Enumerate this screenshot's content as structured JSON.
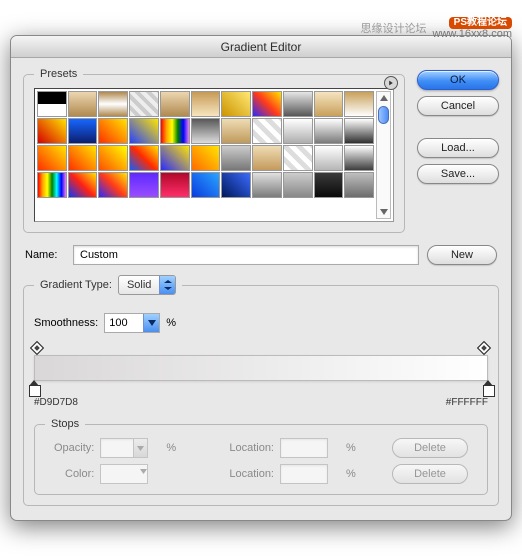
{
  "watermark": {
    "text": "思缘设计论坛",
    "ps": "PS教程论坛",
    "url": "www.16xx8.com"
  },
  "window": {
    "title": "Gradient Editor"
  },
  "presets": {
    "legend": "Presets"
  },
  "buttons": {
    "ok": "OK",
    "cancel": "Cancel",
    "load": "Load...",
    "save": "Save...",
    "new": "New"
  },
  "name": {
    "label": "Name:",
    "value": "Custom"
  },
  "gradient_type": {
    "legend": "Gradient Type:",
    "value": "Solid"
  },
  "smoothness": {
    "label": "Smoothness:",
    "value": "100",
    "unit": "%"
  },
  "stops": {
    "legend": "Stops",
    "opacity_label": "Opacity:",
    "color_label": "Color:",
    "location_label": "Location:",
    "unit": "%",
    "delete": "Delete"
  },
  "color_stops": {
    "left_hex": "#D9D7D8",
    "right_hex": "#FFFFFF"
  },
  "preset_swatches": [
    "linear-gradient(#000 0%,#000 50%,#fff 50%)",
    "linear-gradient(#ecd6b0,#b08a50)",
    "linear-gradient(#b08a50,#fff,#b08a50)",
    "repeating-linear-gradient(45deg,#eee 0 4px,#ccc 4px 8px)",
    "linear-gradient(#ecd6b0,#b08a50)",
    "linear-gradient(#c69a55,#f8e6bf)",
    "linear-gradient(45deg,#cc9400,#ffe873)",
    "linear-gradient(45deg,#2a2aff,#ff3a1a,#ffe400)",
    "linear-gradient(#e6e6e6,#575757)",
    "linear-gradient(#f5e4c0,#c8a05b)",
    "linear-gradient(#c8a05b,#fff)",
    "linear-gradient(45deg,#d50000,#ffe200)",
    "linear-gradient(#1766ff,#0b1e6f)",
    "linear-gradient(45deg,#ff2f00,#ffe400)",
    "linear-gradient(45deg,#2541ff,#ffe400)",
    "linear-gradient(90deg,red,orange,yellow,green,blue,violet)",
    "linear-gradient(#585858,#dcdcdc)",
    "linear-gradient(#eedcb5,#c09a5b)",
    "repeating-linear-gradient(45deg,#fff 0 5px,#ddd 5px 10px)",
    "linear-gradient(#fff,#aeaeae)",
    "linear-gradient(#fff,#7a7a7a)",
    "linear-gradient(#fff,#303030)",
    "linear-gradient(45deg,#ff2f00,#ffe400)",
    "linear-gradient(45deg,#ff2f00,#ffe400)",
    "linear-gradient(45deg,#ff4d00,#ffff00)",
    "linear-gradient(45deg,#105cff,#ff2b00,#ffe400)",
    "linear-gradient(45deg,#2a2aff,#ffe400)",
    "linear-gradient(45deg,#ff6a00,#ffe400)",
    "linear-gradient(#ccc,#777)",
    "linear-gradient(#efdcb4,#c49a5c)",
    "repeating-linear-gradient(45deg,#fff 0 5px,#ddd 5px 10px)",
    "linear-gradient(#fff,#b5b5b5)",
    "linear-gradient(#fff,#3e3e3e)",
    "linear-gradient(90deg,red,orange,yellow,green,cyan,blue,violet)",
    "linear-gradient(45deg,#0c37ff,#ff2214,#ffe200)",
    "linear-gradient(45deg,#2a2aff,#ff3a1a,#ffe400)",
    "linear-gradient(#5e2aff,#9b4dff)",
    "linear-gradient(#b0082b,#ff2f6a)",
    "linear-gradient(45deg,#0a3be0,#2aa4ff)",
    "linear-gradient(45deg,#00185a,#3b6bff)",
    "linear-gradient(#e0e0e0,#7c7c7c)",
    "linear-gradient(#ccc,#888)",
    "linear-gradient(#3a3a3a,#0a0a0a)",
    "linear-gradient(#bfbfbf,#6c6c6c)"
  ]
}
